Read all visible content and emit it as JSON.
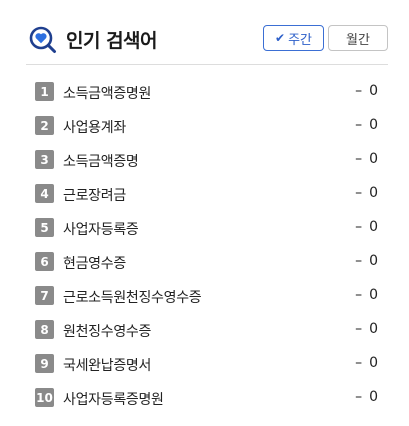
{
  "header": {
    "title": "인기 검색어",
    "icon": "search-heart-icon",
    "accent_color": "#2c5fc9"
  },
  "toggles": {
    "weekly_label": "주간",
    "monthly_label": "월간",
    "selected": "weekly"
  },
  "keywords": [
    {
      "rank": "1",
      "label": "소득금액증명원",
      "trend": "–",
      "change": "0"
    },
    {
      "rank": "2",
      "label": "사업용계좌",
      "trend": "–",
      "change": "0"
    },
    {
      "rank": "3",
      "label": "소득금액증명",
      "trend": "–",
      "change": "0"
    },
    {
      "rank": "4",
      "label": "근로장려금",
      "trend": "–",
      "change": "0"
    },
    {
      "rank": "5",
      "label": "사업자등록증",
      "trend": "–",
      "change": "0"
    },
    {
      "rank": "6",
      "label": "현금영수증",
      "trend": "–",
      "change": "0"
    },
    {
      "rank": "7",
      "label": "근로소득원천징수영수증",
      "trend": "–",
      "change": "0"
    },
    {
      "rank": "8",
      "label": "원천징수영수증",
      "trend": "–",
      "change": "0"
    },
    {
      "rank": "9",
      "label": "국세완납증명서",
      "trend": "–",
      "change": "0"
    },
    {
      "rank": "10",
      "label": "사업자등록증명원",
      "trend": "–",
      "change": "0"
    }
  ]
}
